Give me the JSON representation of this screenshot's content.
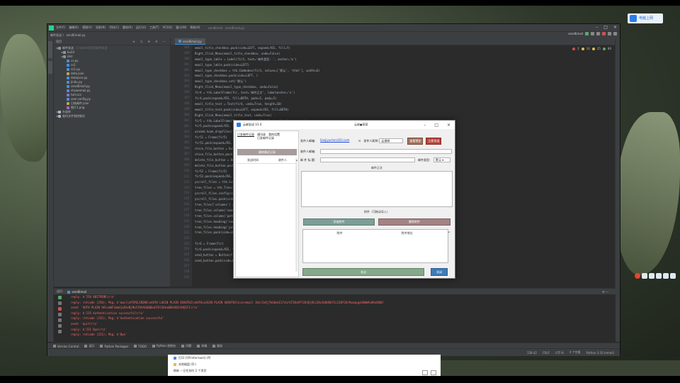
{
  "desktop": {
    "network_button": "电脑上网"
  },
  "ide": {
    "menu": [
      "文件(F)",
      "编辑(E)",
      "视图(V)",
      "导航(N)",
      "代码(C)",
      "重构(R)",
      "运行(U)",
      "工具(T)",
      "VCS(S)",
      "窗口(W)",
      "帮助(H)"
    ],
    "title_path": "sendEmail - sendEmail.py",
    "breadcrumb": "邮件发送  〉 sendEmail.py",
    "run_config": "sendEmail",
    "project_header": "项目",
    "tree": [
      {
        "label": "邮件发送",
        "hint": "C:\\Users\\项目\\邮件发送",
        "type": "folder",
        "depth": 0
      },
      {
        "label": "build",
        "type": "folder",
        "depth": 1
      },
      {
        "label": "dist",
        "type": "folder",
        "depth": 1
      },
      {
        "label": "cs.py",
        "type": "py",
        "depth": 2
      },
      {
        "label": "cs1",
        "type": "py",
        "depth": 2
      },
      {
        "label": "cs1.py",
        "type": "py",
        "depth": 2
      },
      {
        "label": "data.json",
        "type": "json",
        "depth": 2
      },
      {
        "label": "datajson.py",
        "type": "py",
        "depth": 2
      },
      {
        "label": "jindu.py",
        "type": "py",
        "depth": 2
      },
      {
        "label": "sendEmail.py",
        "type": "py",
        "depth": 2
      },
      {
        "label": "showemail.py",
        "type": "py",
        "depth": 2
      },
      {
        "label": "tuhi.ico",
        "type": "png",
        "depth": 2
      },
      {
        "label": "user.config.py",
        "type": "py",
        "depth": 2
      },
      {
        "label": "日结邮件.json",
        "type": "json",
        "depth": 2
      },
      {
        "label": "图片1.png",
        "type": "png",
        "depth": 2
      },
      {
        "label": "外部库",
        "type": "lib",
        "depth": 0
      },
      {
        "label": "临时文件和控制台",
        "type": "lib",
        "depth": 0
      }
    ],
    "editor_tab": "sendEmail.py",
    "inspections": {
      "errors": "2",
      "warnings": "16",
      "weak": "25",
      "typos": "80"
    },
    "line_numbers": [
      "188",
      "189",
      "190",
      "191",
      "192",
      "193",
      "194",
      "195",
      "196",
      "197",
      "198",
      "199",
      "200",
      "201",
      "202",
      "203",
      "204",
      "205",
      "206",
      "207",
      "208",
      "209",
      "210",
      "211",
      "212",
      "213",
      "214",
      "215",
      "216",
      "217",
      "218",
      "219",
      "220",
      "221",
      "222",
      "223",
      "224",
      "225",
      "226",
      "227",
      "228",
      "229"
    ],
    "code_lines": [
      "email_title_checkbox.pack(side=LEFT, expand=YES, fill=Y)",
      "Right_Click_Menu(email_title_checkbox, undo=False)",
      "email_type_lable = Label(fir3, text='邮件类型: ', anchor='w')",
      "email_type_lable.pack(side=LEFT)",
      "email_type_checkbox = ttk.Combobox(fir3, values=['默认', 'html'], width=6)",
      "email_type_checkbox.pack(side=LEFT, )",
      "email_type_checkbox.set('默认')",
      "Right_Click_Menu(email_type_checkbox, undo=False)",
      "fir4 = ttk.LabelFrame(fir, text='邮件正文', labelanchor='n')",
      "fir4.pack(expand=YES, fill=BOTH, padx=5, pady=5)",
      "email_title_text = Text(fir4, undo=True, height=10)",
      "email_title_text.pack(side=LEFT, expand=YES, fill=BOTH)",
      "Right_Click_Menu(email_title_text, undo=True)",
      "fir5 = ttk.LabelFrame(fir, text='附件(可拖动导入)', labelanchor='n')",
      "fir5.pack(expand=YES, fill=BOTH)",
      "windnd.hook_dropfiles(fir5, func=dragged_files)",
      "fir51 = Frame(fir5)",
      "fir51.pack(expand=YES, fill=X)",
      "chice_file_button = Button(fir51, text='添加附件')",
      "chice_file_button.pack(side=LEFT, expand=YES, fill=X)",
      "delete_file_button = Button(fir51, text='删除附件')",
      "delete_file_button.pack(side=LEFT, expand=YES, fill=X)",
      "fir52 = Frame(fir5)",
      "fir52.pack(expand=YES, fill=BOTH)",
      "yscroll_files = ttk.Scrollbar(fir52, orient=VERTICAL)",
      "tree_files = ttk.Treeview(fir52, show='headings')",
      "yscroll_files.config(command=tree_files.yview)",
      "yscroll_files.pack(side=RIGHT, fill=Y)",
      "tree_files['columns'] = ('name', 'path')",
      "tree_files.column('name', width=60)",
      "tree_files.column('path', width=200)",
      "tree_files.heading('name', text='附件')",
      "tree_files.heading('path', text='附件地址')",
      "tree_files.pack(side=LEFT, expand=YES, fill=BOTH)",
      "",
      "fir6 = Frame(fir)",
      "fir6.pack(expand=YES, fill=X)",
      "send_button = Button(fir6, text='发送')",
      "send_button.pack(side=LEFT, expand=YES, fill=X)"
    ],
    "run_header": "运行:",
    "run_tab": "sendEmail",
    "run_output": [
      "reply: b'250 8BITMIME\\r\\n'",
      "reply: retcode (250); Msg: b'mail\\nPIPELINING\\nAUTH LOGIN PLAIN XOAUTH2\\nAUTH=LOGIN PLAIN XOAUTH2\\ncoremail 1Uxr2xKj7kG0xkI17xGrU7I0s8FY2U3Uj8Cz28x1UUUUU7Ic2I0Y2UrRuwnpgxUXWmRvbRnXDUU'",
      "send: 'AUTH PLAIN AHlsaWF1bmdjeEAxNjMuY29tAEdBQ0xGTUlSUkxWUkVGQlVUQ1FJ\\r\\n'",
      "reply: b'235 Authentication successful\\r\\n'",
      "reply: retcode (235); Msg: b'Authentication successful'",
      "send: 'quit\\r\\n'",
      "reply: b'221 Bye\\r\\n'",
      "reply: retcode (221); Msg: b'Bye'"
    ],
    "bottom_tools": [
      "Version Control",
      "运行",
      "Python Packages",
      "TODO",
      "Python 控制台",
      "问题",
      "终端",
      "服务"
    ],
    "status": [
      "158:42",
      "CRLF",
      "UTF-8",
      "4 个空格",
      "Python 3.10 (email)"
    ]
  },
  "dialog": {
    "title": "云邮发送 V1.0",
    "center_caption": "云邮●萌萌",
    "left_menu": [
      "已发邮件记录",
      "通讯录",
      "我的设置",
      "已发邮件记录"
    ],
    "clear_button": "删除最近记录",
    "left_cols": [
      "发送时间",
      "收件人"
    ],
    "sender_label": "发件人邮箱:",
    "sender_value": "liaojiyuchen163.com",
    "sender_name_label": "发件人昵称:",
    "sender_name_value": "云逸邮",
    "preview_button": "查看预览",
    "quick_send_button": "立即发送",
    "recipient_label": "收件人邮箱:",
    "recipient_value": "",
    "subject_label": "邮 件 标 题:",
    "subject_value": "",
    "type_label": "邮件类型:",
    "type_value": "默认",
    "body_section": "邮件正文",
    "attach_section": "附件（可拖动导入）",
    "add_attach_button": "添加附件",
    "delete_attach_button": "删除附件",
    "attach_cols": [
      "附件",
      "附件地址"
    ],
    "send_button": "发送",
    "close_button": "关闭"
  },
  "explorer": {
    "rows": [
      "打印 (\\\\Printerroom) (P)",
      "本地磁盘 (D:)",
      "刷新  一旦任务时 2 个项目"
    ]
  }
}
